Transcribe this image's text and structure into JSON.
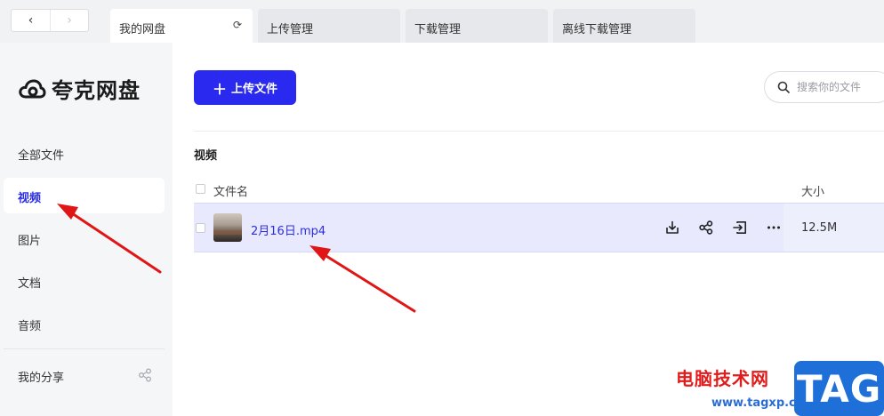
{
  "nav": {
    "back": "‹",
    "forward": "›"
  },
  "tabs": [
    {
      "label": "我的网盘",
      "active": true
    },
    {
      "label": "上传管理",
      "active": false
    },
    {
      "label": "下载管理",
      "active": false
    },
    {
      "label": "离线下载管理",
      "active": false
    }
  ],
  "sidebar": {
    "logo_text": "夸克网盘",
    "items": [
      {
        "label": "全部文件",
        "active": false
      },
      {
        "label": "视频",
        "active": true
      },
      {
        "label": "图片",
        "active": false
      },
      {
        "label": "文档",
        "active": false
      },
      {
        "label": "音频",
        "active": false
      }
    ],
    "share_label": "我的分享"
  },
  "main": {
    "upload_label": "上传文件",
    "search_placeholder": "搜索你的文件",
    "section_title": "视频",
    "columns": {
      "name": "文件名",
      "size": "大小"
    },
    "files": [
      {
        "name": "2月16日.mp4",
        "size": "12.5M"
      }
    ]
  },
  "colors": {
    "accent": "#2929f0",
    "link": "#2b2ee0",
    "selected_row": "#e8e9fd",
    "arrow": "#e01515"
  },
  "watermark": {
    "site_name": "电脑技术网",
    "url": "www.tagxp.com",
    "tag": "TAG"
  }
}
